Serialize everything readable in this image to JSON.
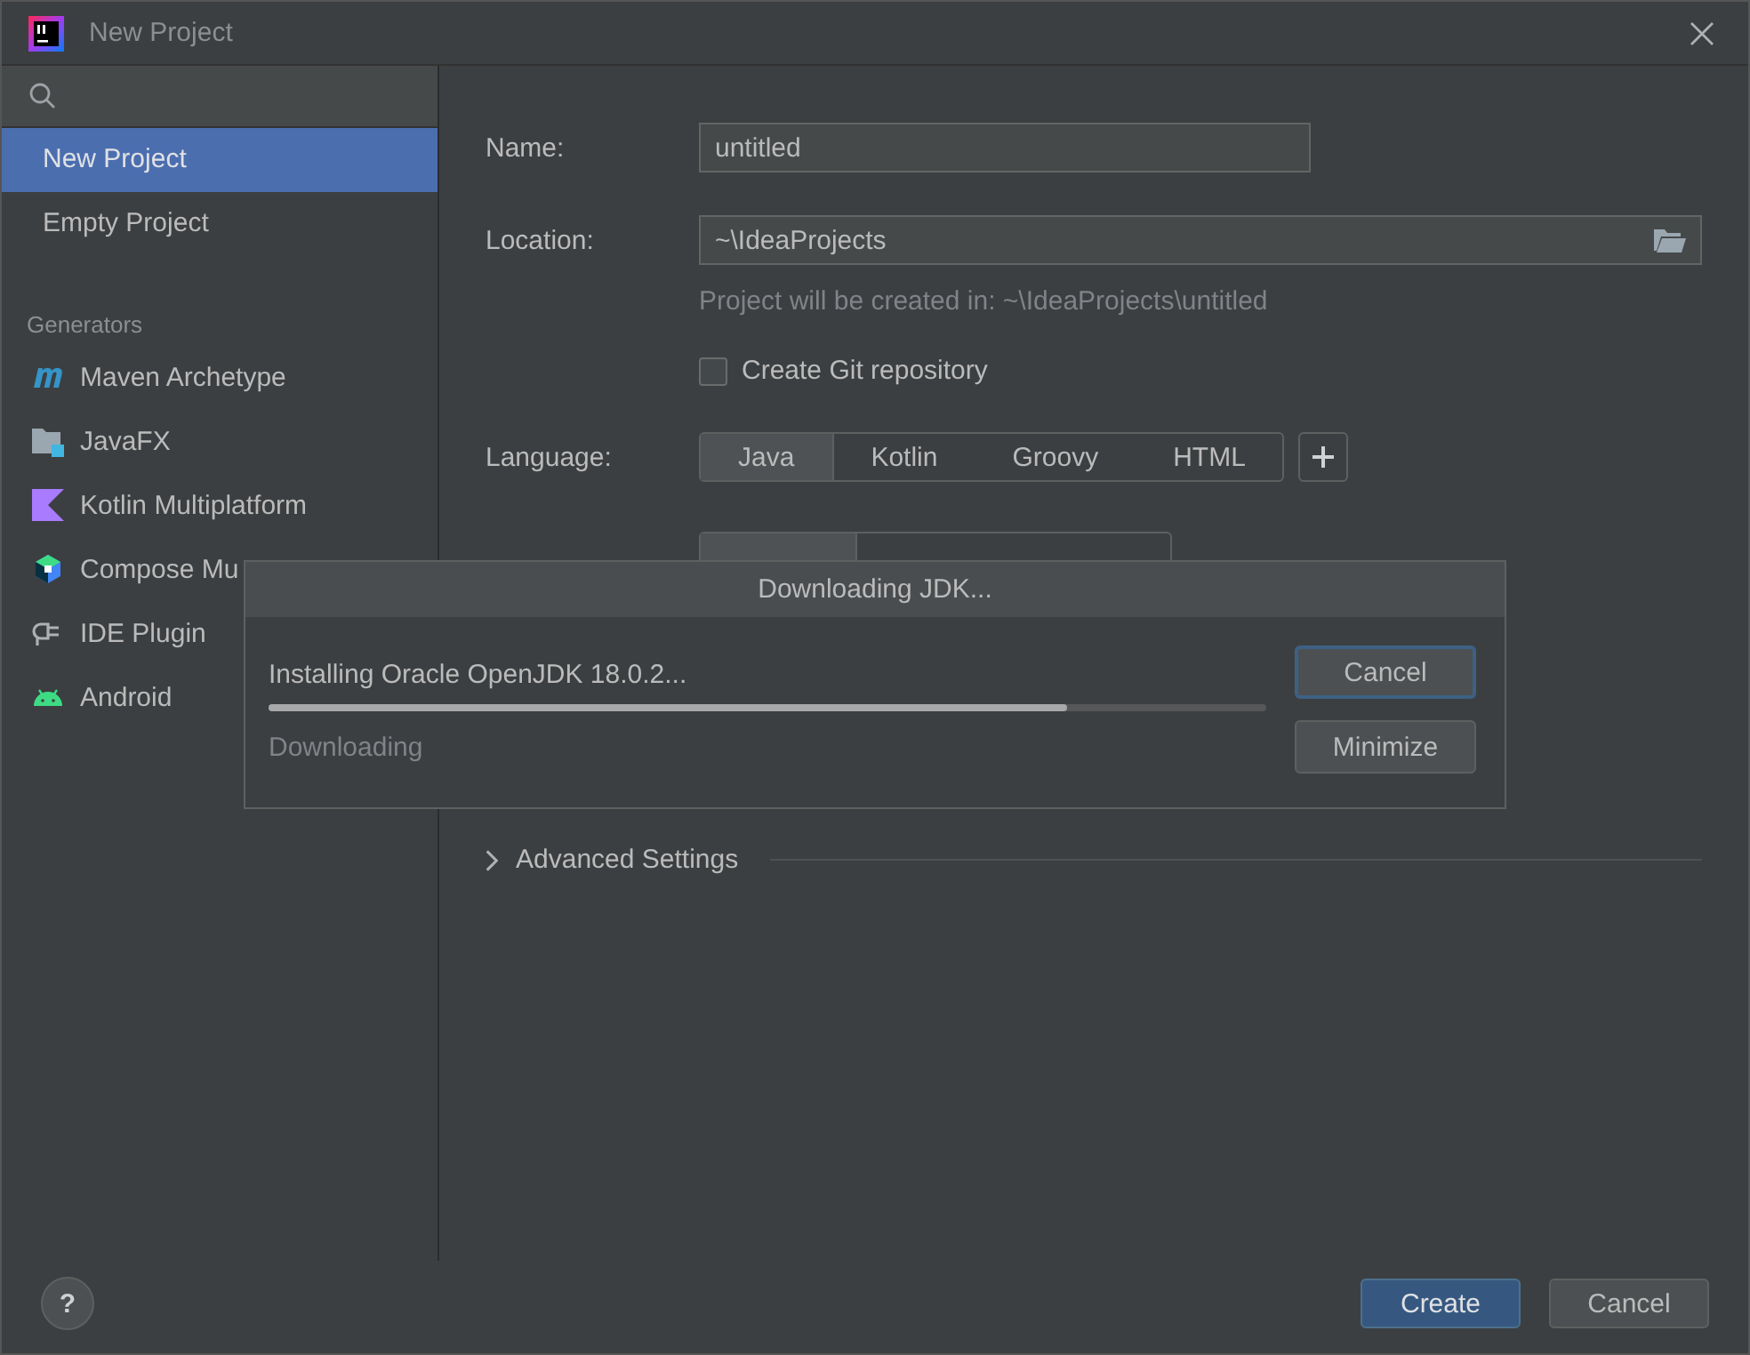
{
  "window": {
    "title": "New Project"
  },
  "sidebar": {
    "items": [
      {
        "label": "New Project",
        "selected": true
      },
      {
        "label": "Empty Project",
        "selected": false
      }
    ],
    "section": "Generators",
    "generators": [
      {
        "label": "Maven Archetype",
        "kind": "maven"
      },
      {
        "label": "JavaFX",
        "kind": "javafx"
      },
      {
        "label": "Kotlin Multiplatform",
        "kind": "kotlin"
      },
      {
        "label": "Compose Mu",
        "kind": "compose"
      },
      {
        "label": "IDE Plugin",
        "kind": "plugin"
      },
      {
        "label": "Android",
        "kind": "android"
      }
    ]
  },
  "form": {
    "name": {
      "label": "Name:",
      "value": "untitled"
    },
    "location": {
      "label": "Location:",
      "value": "~\\IdeaProjects"
    },
    "location_hint": "Project will be created in: ~\\IdeaProjects\\untitled",
    "git": {
      "label": "Create Git repository",
      "checked": false
    },
    "language": {
      "label": "Language:",
      "options": [
        {
          "label": "Java",
          "selected": true
        },
        {
          "label": "Kotlin",
          "selected": false
        },
        {
          "label": "Groovy",
          "selected": false
        },
        {
          "label": "HTML",
          "selected": false
        }
      ]
    },
    "build_system": {
      "options": [
        {
          "selected": true
        },
        {
          "selected": false
        },
        {
          "selected": false
        }
      ]
    },
    "advanced": {
      "label": "Advanced Settings",
      "expanded": false
    }
  },
  "dialog": {
    "title": "Downloading JDK...",
    "message": "Installing Oracle OpenJDK 18.0.2...",
    "level": 0.8,
    "status": "Downloading",
    "buttons": [
      {
        "label": "Cancel",
        "focused": true
      },
      {
        "label": "Minimize",
        "focused": false
      }
    ]
  },
  "footer": {
    "help": "?",
    "buttons": [
      {
        "label": "Create",
        "kind": "primary"
      },
      {
        "label": "Cancel",
        "kind": "secondary"
      }
    ]
  }
}
